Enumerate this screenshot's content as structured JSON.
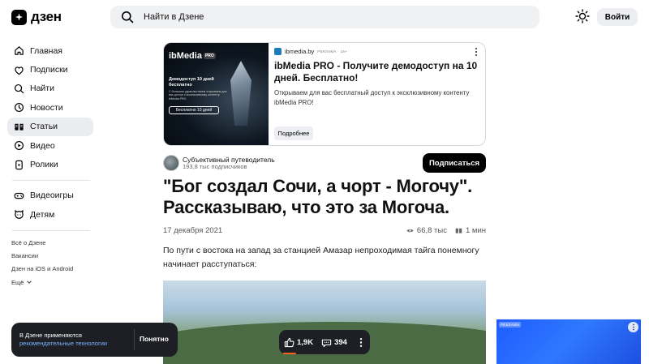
{
  "header": {
    "logo_text": "дзен",
    "search_placeholder": "Найти в Дзене",
    "login_label": "Войти"
  },
  "sidebar": {
    "items": [
      {
        "label": "Главная",
        "icon": "home-icon"
      },
      {
        "label": "Подписки",
        "icon": "subscriptions-icon"
      },
      {
        "label": "Найти",
        "icon": "search-icon"
      },
      {
        "label": "Новости",
        "icon": "news-icon"
      },
      {
        "label": "Статьи",
        "icon": "articles-icon",
        "active": true
      },
      {
        "label": "Видео",
        "icon": "video-icon"
      },
      {
        "label": "Ролики",
        "icon": "shorts-icon"
      }
    ],
    "extra_items": [
      {
        "label": "Видеоигры",
        "icon": "gamepad-icon"
      },
      {
        "label": "Детям",
        "icon": "kids-icon"
      }
    ],
    "footer_links": [
      "Всё о Дзене",
      "Вакансии",
      "Дзен на iOS и Android",
      "Ещё"
    ]
  },
  "ad": {
    "source": "ibmedia.by",
    "tag": "РЕКЛАМА · 16+",
    "title": "ibMedia PRO - Получите демодоступ на 10 дней. Бесплатно!",
    "description": "Открываем для вас бесплатный доступ к эксклюзивному контенту ibMedia PRO!",
    "more_label": "Подробнее",
    "image": {
      "brand": "ibMedia",
      "pro": "PRO",
      "line1": "Демодоступ 10 дней бесплатно",
      "line2": "С большим удовольствием открываем для вас доступ к эксклюзивному контенту ibMedia PRO",
      "button": "Бесплатно 10 дней"
    }
  },
  "channel": {
    "name": "Субъективный путеводитель",
    "subscribers": "193,8 тыс подписчиков",
    "subscribe_label": "Подписаться"
  },
  "article": {
    "title": "\"Бог создал Сочи, а чорт - Могочу\". Рассказываю, что это за Могоча.",
    "date": "17 декабря 2021",
    "views": "66,8 тыс",
    "read_time": "1 мин",
    "paragraph": "По пути с востока на запад за станцией Амазар непроходимая тайга понемногу начинает расступаться:"
  },
  "cookie": {
    "text": "В Дзене применяются",
    "link": "рекомендательные технологии",
    "button": "Понятно"
  },
  "reactions": {
    "likes": "1,9K",
    "comments": "394"
  },
  "side_ad": {
    "tag": "РЕКЛАМА"
  }
}
